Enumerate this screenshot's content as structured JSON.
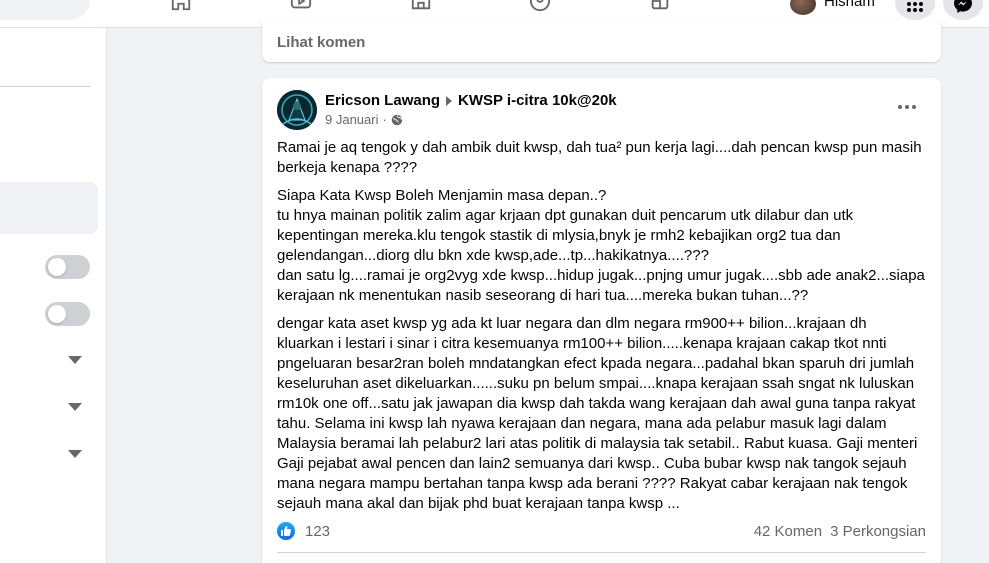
{
  "topbar": {
    "profile_name": "Hisham",
    "nav_icons": [
      "home-icon",
      "watch-icon",
      "marketplace-icon",
      "groups-icon",
      "gaming-icon"
    ],
    "menu_icon": "grid-menu-icon",
    "messenger_icon": "messenger-icon"
  },
  "sidebar": {
    "toggles": [
      false,
      false
    ],
    "expanders": [
      "chevron-down-icon",
      "chevron-down-icon",
      "chevron-down-icon"
    ]
  },
  "prev_post": {
    "view_comments": "Lihat komen"
  },
  "post": {
    "author": "Ericson Lawang",
    "group": "KWSP i-citra 10k@20k",
    "date": "9 Januari",
    "privacy_icon": "globe-icon",
    "paragraphs": [
      "Ramai je aq tengok y dah ambik duit kwsp, dah tua² pun kerja lagi....dah pencan kwsp pun masih berkeja kenapa ????",
      "Siapa Kata Kwsp Boleh Menjamin masa depan..?\ntu hnya mainan politik zalim agar krjaan dpt gunakan duit pencarum utk dilabur dan utk kepentingan mereka.klu tengok stastik di mlysia,bnyk je rmh2 kebajikan org2 tua dan gelendangan...diorg dlu bkn xde kwsp,ade...tp...hakikatnya....???\ndan satu lg....ramai je org2vyg xde kwsp...hidup jugak...pnjng umur jugak....sbb ade anak2...siapa kerajaan nk menentukan nasib seseorang di hari tua....mereka bukan tuhan...??",
      "dengar kata aset kwsp yg ada kt luar negara dan dlm negara rm900++ bilion...krajaan dh kluarkan i lestari i sinar i citra kesemuanya rm100++ bilion.....kenapa krajaan cakap tkot nnti pngeluaran besar2ran boleh mndatangkan efect kpada negara...padahal bkan sparuh dri jumlah keseluruhan aset dikeluarkan......suku pn belum smpai....knapa kerajaan ssah sngat nk luluskan rm10k one off...satu jak jawapan dia kwsp dah takda wang kerajaan dah awal guna tanpa rakyat tahu. Selama ini kwsp lah nyawa kerajaan dan negara, mana ada pelabur masuk lagi dalam Malaysia beramai lah pelabur2 lari atas politik di malaysia tak setabil.. Rabut kuasa. Gaji menteri Gaji pejabat awal pencen dan lain2 semuanya dari kwsp.. Cuba bubar kwsp nak tangok sejauh mana negara mampu bertahan tanpa kwsp ada berani ???? Rakyat cabar kerajaan nak tengok sejauh mana akal dan bijak phd buat kerajaan tanpa kwsp ..."
    ],
    "like_count": "123",
    "comments": "42 Komen",
    "shares": "3 Perkongsian",
    "like_color": "#0866ff"
  }
}
